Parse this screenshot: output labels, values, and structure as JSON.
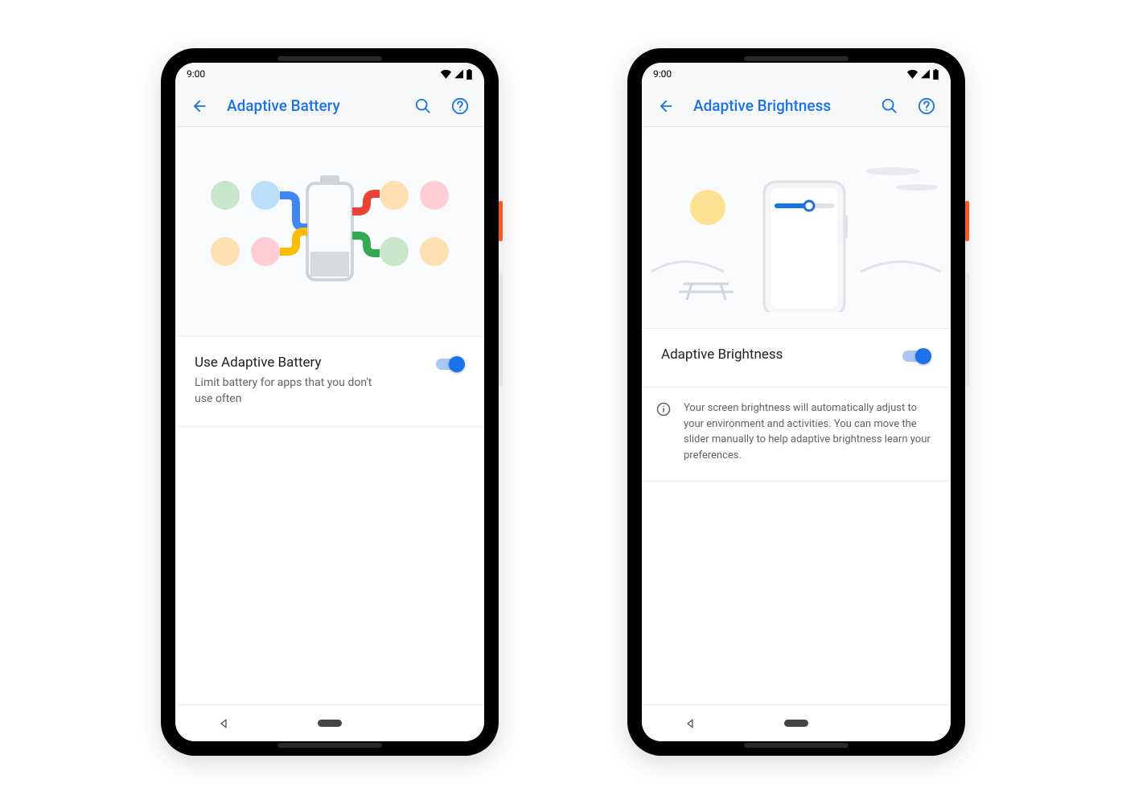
{
  "statusbar": {
    "time": "9:00"
  },
  "colors": {
    "accent": "#1a73e8"
  },
  "phones": [
    {
      "title": "Adaptive Battery",
      "setting": {
        "primary": "Use Adaptive Battery",
        "secondary": "Limit battery for apps that you don't use often",
        "enabled": true
      }
    },
    {
      "title": "Adaptive Brightness",
      "setting": {
        "primary": "Adaptive Brightness",
        "enabled": true
      },
      "info": "Your screen brightness will automatically adjust to your environment and activities. You can move the slider manually to help adaptive brightness learn your preferences."
    }
  ]
}
